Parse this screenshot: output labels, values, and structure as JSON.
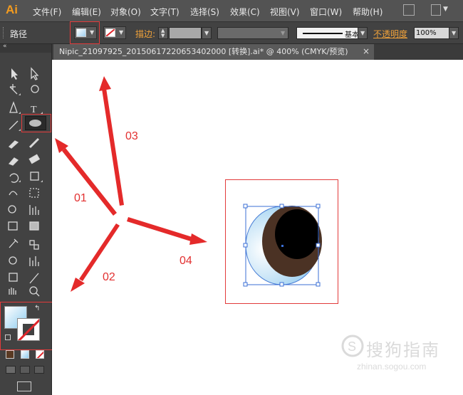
{
  "app": {
    "logo": "Ai"
  },
  "menubar": {
    "items": [
      {
        "label": "文件(F)"
      },
      {
        "label": "编辑(E)"
      },
      {
        "label": "对象(O)"
      },
      {
        "label": "文字(T)"
      },
      {
        "label": "选择(S)"
      },
      {
        "label": "效果(C)"
      },
      {
        "label": "视图(V)"
      },
      {
        "label": "窗口(W)"
      },
      {
        "label": "帮助(H)"
      }
    ]
  },
  "controlbar": {
    "selection_label": "路径",
    "stroke_label": "描边:",
    "stroke_style": "基本",
    "opacity_label": "不透明度",
    "opacity_value": "100%"
  },
  "document": {
    "tab_title": "Nipic_21097925_20150617220653402000 [转换].ai* @ 400% (CMYK/预览)",
    "close_symbol": "×"
  },
  "annotations": {
    "labels": [
      "01",
      "02",
      "03",
      "04"
    ]
  },
  "watermark": {
    "text": "搜狗指南",
    "url": "zhinan.sogou.com"
  }
}
